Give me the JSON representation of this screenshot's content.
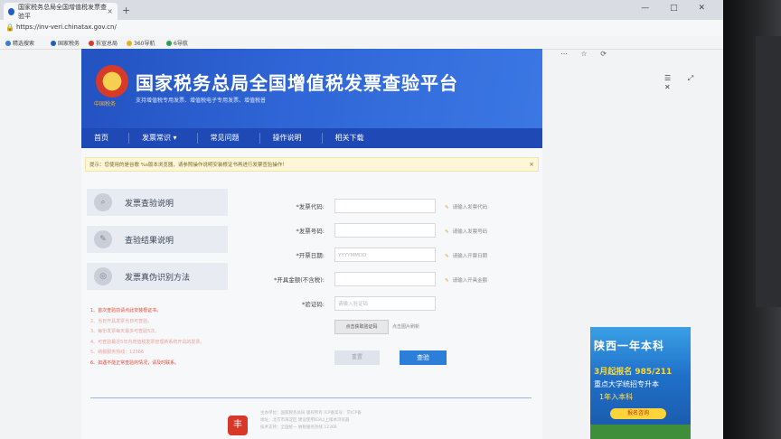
{
  "browser": {
    "tab_title": "国家税务总局全国增值税发票查验平",
    "tab_close": "×",
    "new_tab": "+",
    "url": "https://inv-veri.chinatax.gov.cn/",
    "bookmarks": [
      "精选搜索",
      "国家税务",
      "拆宣总局",
      "360导航",
      "6导航"
    ],
    "window_controls": "— □ ✕"
  },
  "header": {
    "title": "国家税务总局全国增值税发票查验平台",
    "subtitle": "支持增值税专用发票、增值税电子专用发票、增值税普",
    "emblem_text": "中国税务"
  },
  "nav": {
    "items": [
      "首页",
      "发票常识 ▾",
      "常见问题",
      "操作说明",
      "相关下载"
    ]
  },
  "notice": {
    "text": "提示：您使用的是谷歌 %s版本浏览器，请参照操作说明安装根证书再进行发票查验操作！",
    "close": "×"
  },
  "sidebar": {
    "items": [
      {
        "label": "发票查验说明",
        "icon": "magnifier-icon"
      },
      {
        "label": "查验结果说明",
        "icon": "pencil-icon"
      },
      {
        "label": "发票真伪识别方法",
        "icon": "shield-icon"
      }
    ]
  },
  "notes": [
    {
      "text": "1、首次查验前请点此安装根证书。",
      "color": "#e24a3a"
    },
    {
      "text": "2、当日开具发票当日可查验。",
      "color": "#e8a3a0"
    },
    {
      "text": "3、每份发票每天最多可查验5次。",
      "color": "#e8a3a0"
    },
    {
      "text": "4、可查验最近5年内增值税发票管理新系统开具的发票。",
      "color": "#e8a3a0"
    },
    {
      "text": "5、纳税服务热线：12366",
      "color": "#e8a3a0"
    },
    {
      "text": "6、如遇不能正常查验的情况，请及时联系。",
      "color": "#e24a3a"
    }
  ],
  "form": {
    "fields": [
      {
        "label": "*发票代码:",
        "placeholder": "",
        "hint": "请输入发票代码"
      },
      {
        "label": "*发票号码:",
        "placeholder": "",
        "hint": "请输入发票号码"
      },
      {
        "label": "*开票日期:",
        "placeholder": "YYYYMMDD",
        "hint": "请输入开票日期"
      },
      {
        "label": "*开具金额(不含税):",
        "placeholder": "",
        "hint": "请输入开具金额"
      },
      {
        "label": "*验证码:",
        "placeholder": "请输入验证码",
        "hint": ""
      }
    ],
    "captcha_button": "点击获取验证码",
    "captcha_hint": "点击图片刷新",
    "reset_label": "重置",
    "check_label": "查验"
  },
  "footer": {
    "lines": [
      "主办单位：国家税务总局 版权所有 ICP备案号：京ICP备",
      "地址：北京市海淀区 建议使用IE8以上版本浏览器",
      "技术支持：全国统一 纳税服务热线 12366"
    ],
    "logo_glyph": "丰"
  },
  "ad": {
    "title": "陕西一年本科",
    "line1": "3月起报名 985/211",
    "line2": "重点大学统招专升本",
    "line3": "1年入本科",
    "button": "报名咨询"
  },
  "colors": {
    "banner": "#2f65d6",
    "nav": "#1f4ab5",
    "primary_button": "#2c7fd8",
    "notice_bg": "#fdf6d8"
  }
}
